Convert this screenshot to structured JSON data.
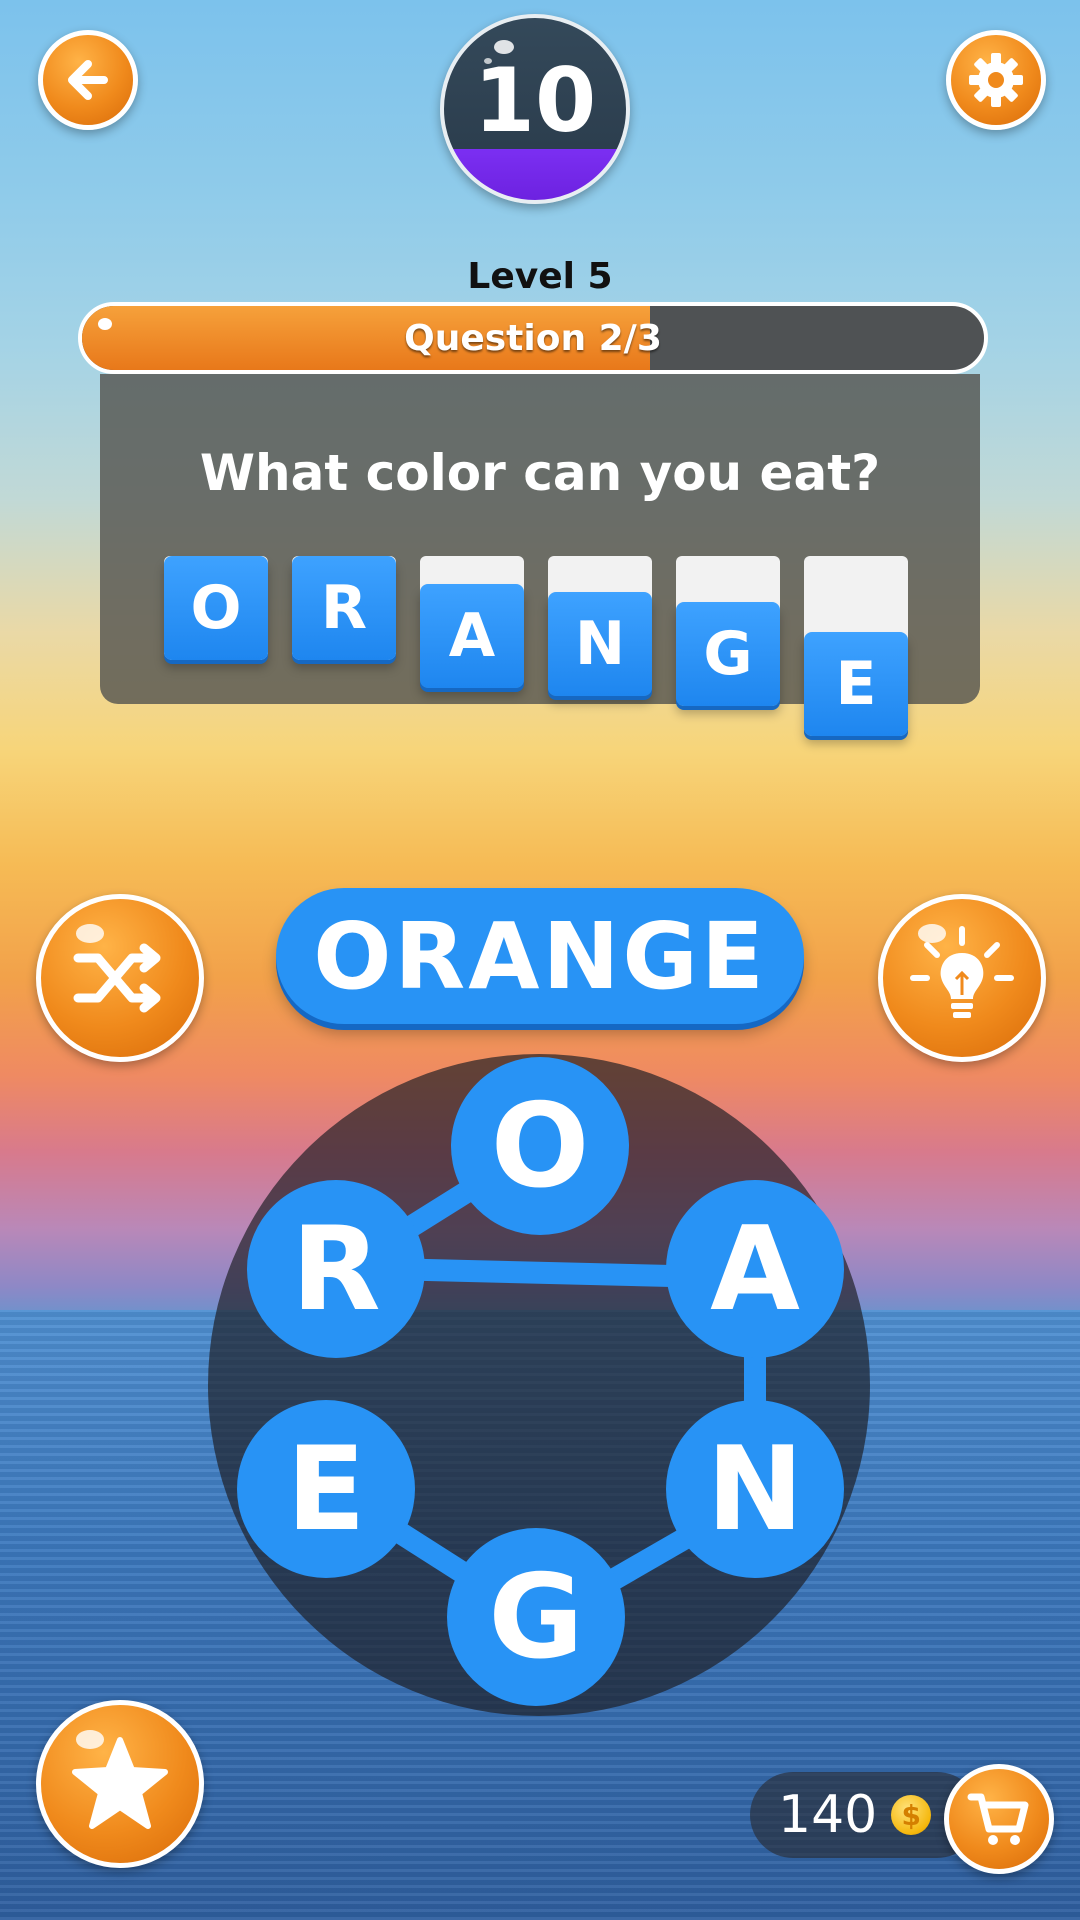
{
  "header": {
    "back_icon": "arrow-left-icon",
    "settings_icon": "gear-icon",
    "score": "10"
  },
  "level": {
    "label": "Level 5",
    "question_progress": "Question 2/3",
    "progress_fraction": 0.63
  },
  "question": {
    "text": "What color can you eat?",
    "answer_tiles": [
      "O",
      "R",
      "A",
      "N",
      "G",
      "E"
    ]
  },
  "current_word": "ORANGE",
  "controls": {
    "shuffle_icon": "shuffle-icon",
    "hint_icon": "lightbulb-icon",
    "favorite_icon": "star-icon",
    "shop_icon": "cart-icon"
  },
  "wheel_letters": [
    "O",
    "A",
    "N",
    "G",
    "E",
    "R"
  ],
  "coins": {
    "amount": "140",
    "symbol": "$"
  },
  "colors": {
    "accent_orange": "#f08a1c",
    "tile_blue": "#2893f5",
    "progress_bar_bg": "#4f5254",
    "score_purple": "#7b2ff2"
  }
}
